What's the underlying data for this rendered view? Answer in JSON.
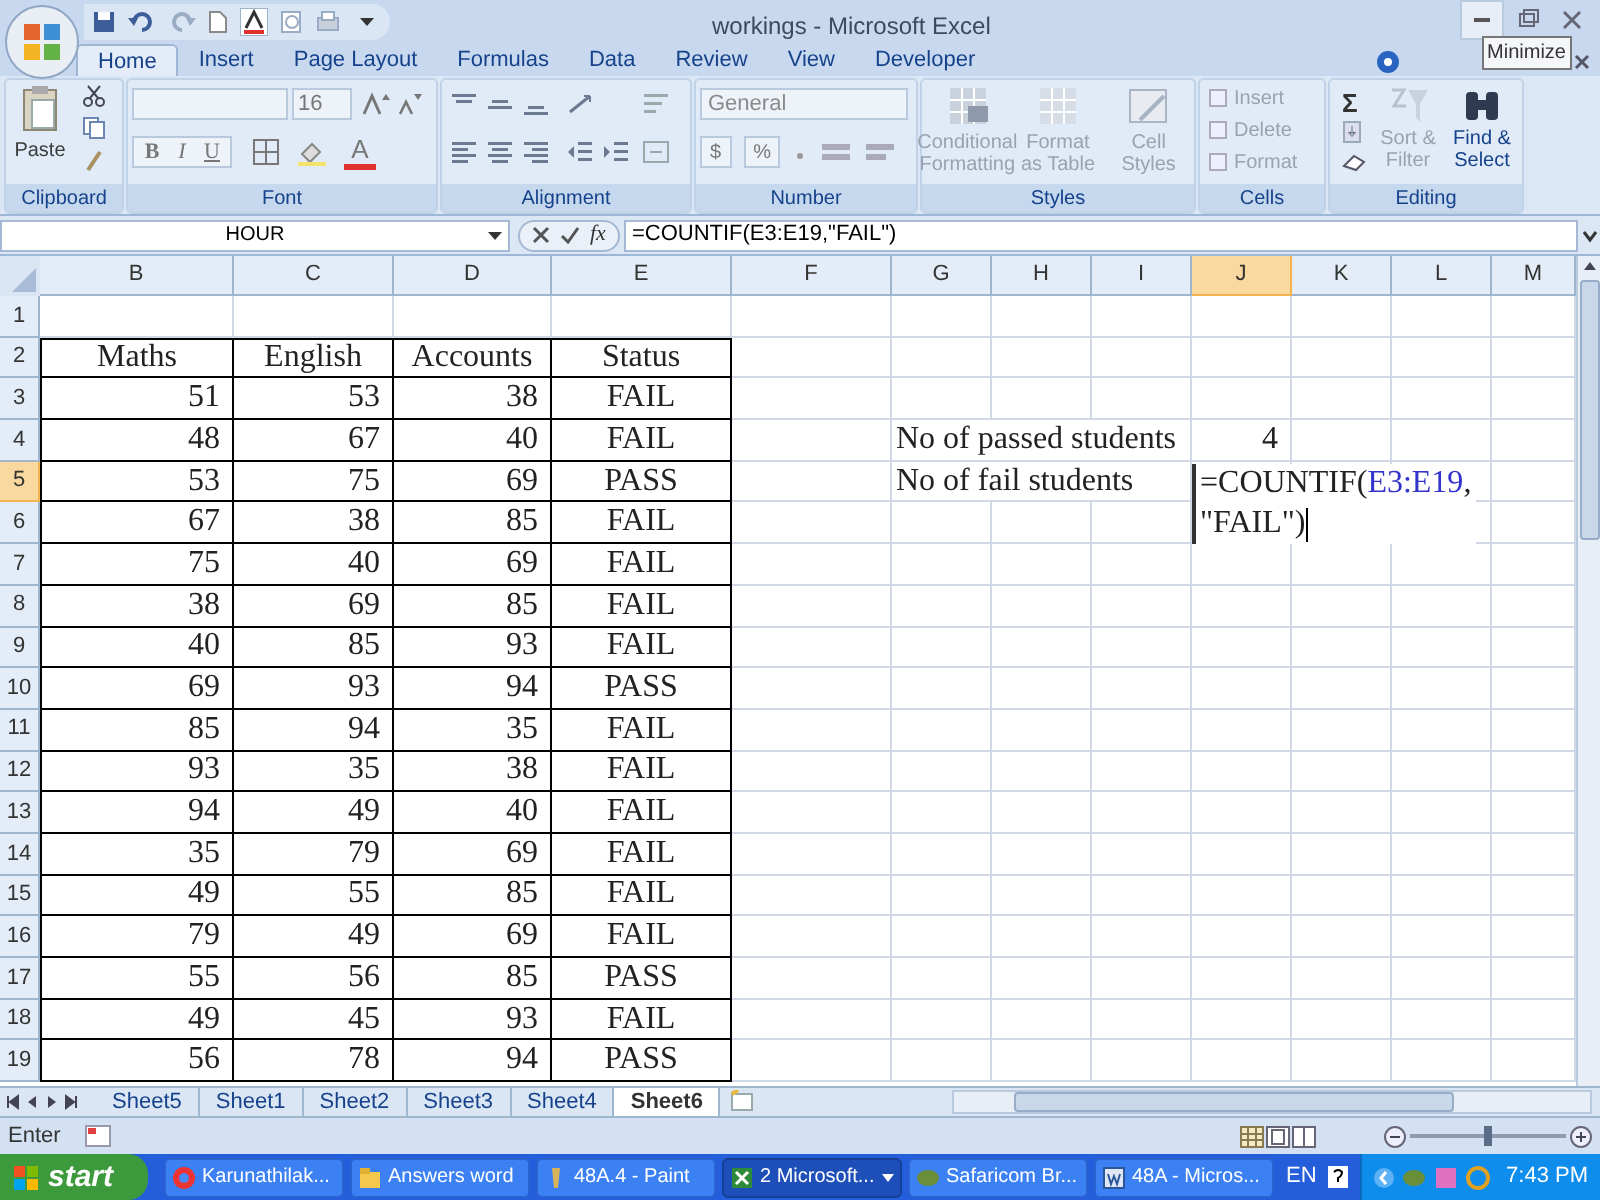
{
  "window": {
    "title": "workings - Microsoft Excel",
    "tooltip": "Minimize"
  },
  "ribbon_tabs": [
    {
      "label": "Home",
      "selected": true
    },
    {
      "label": "Insert",
      "selected": false
    },
    {
      "label": "Page Layout",
      "selected": false
    },
    {
      "label": "Formulas",
      "selected": false
    },
    {
      "label": "Data",
      "selected": false
    },
    {
      "label": "Review",
      "selected": false
    },
    {
      "label": "View",
      "selected": false
    },
    {
      "label": "Developer",
      "selected": false
    }
  ],
  "ribbon": {
    "paste": "Paste",
    "font_size": "16",
    "font_styles": [
      "B",
      "I",
      "U"
    ],
    "font_color_letter": "A",
    "number_format": "General",
    "number_symbols": [
      "$",
      "%"
    ],
    "styles": [
      "Conditional Formatting",
      "Format as Table",
      "Cell Styles"
    ],
    "cells": [
      "Insert",
      "Delete",
      "Format"
    ],
    "sum_symbol": "Σ",
    "editing": [
      "Sort & Filter",
      "Find & Select"
    ],
    "groups": [
      "Clipboard",
      "Font",
      "Alignment",
      "Number",
      "Styles",
      "Cells",
      "Editing"
    ]
  },
  "formula_bar": {
    "name_box": "HOUR",
    "fx": "fx",
    "formula": "=COUNTIF(E3:E19,\"FAIL\")"
  },
  "columns": [
    {
      "label": "B",
      "selected": false
    },
    {
      "label": "C",
      "selected": false
    },
    {
      "label": "D",
      "selected": false
    },
    {
      "label": "E",
      "selected": false
    },
    {
      "label": "F",
      "selected": false
    },
    {
      "label": "G",
      "selected": false
    },
    {
      "label": "H",
      "selected": false
    },
    {
      "label": "I",
      "selected": false
    },
    {
      "label": "J",
      "selected": true
    },
    {
      "label": "K",
      "selected": false
    },
    {
      "label": "L",
      "selected": false
    },
    {
      "label": "M",
      "selected": false
    }
  ],
  "row_numbers": [
    {
      "number": "1",
      "selected": false
    },
    {
      "number": "2",
      "selected": false
    },
    {
      "number": "3",
      "selected": false
    },
    {
      "number": "4",
      "selected": false
    },
    {
      "number": "5",
      "selected": true
    },
    {
      "number": "6",
      "selected": false
    },
    {
      "number": "7",
      "selected": false
    },
    {
      "number": "8",
      "selected": false
    },
    {
      "number": "9",
      "selected": false
    },
    {
      "number": "10",
      "selected": false
    },
    {
      "number": "11",
      "selected": false
    },
    {
      "number": "12",
      "selected": false
    },
    {
      "number": "13",
      "selected": false
    },
    {
      "number": "14",
      "selected": false
    },
    {
      "number": "15",
      "selected": false
    },
    {
      "number": "16",
      "selected": false
    },
    {
      "number": "17",
      "selected": false
    },
    {
      "number": "18",
      "selected": false
    },
    {
      "number": "19",
      "selected": false
    }
  ],
  "table": {
    "header": [
      "Maths",
      "English",
      "Accounts",
      "Status"
    ],
    "rows": [
      [
        "51",
        "53",
        "38",
        "FAIL"
      ],
      [
        "48",
        "67",
        "40",
        "FAIL"
      ],
      [
        "53",
        "75",
        "69",
        "PASS"
      ],
      [
        "67",
        "38",
        "85",
        "FAIL"
      ],
      [
        "75",
        "40",
        "69",
        "FAIL"
      ],
      [
        "38",
        "69",
        "85",
        "FAIL"
      ],
      [
        "40",
        "85",
        "93",
        "FAIL"
      ],
      [
        "69",
        "93",
        "94",
        "PASS"
      ],
      [
        "85",
        "94",
        "35",
        "FAIL"
      ],
      [
        "93",
        "35",
        "38",
        "FAIL"
      ],
      [
        "94",
        "49",
        "40",
        "FAIL"
      ],
      [
        "35",
        "79",
        "69",
        "FAIL"
      ],
      [
        "49",
        "55",
        "85",
        "FAIL"
      ],
      [
        "79",
        "49",
        "69",
        "FAIL"
      ],
      [
        "55",
        "56",
        "85",
        "PASS"
      ],
      [
        "49",
        "45",
        "93",
        "FAIL"
      ],
      [
        "56",
        "78",
        "94",
        "PASS"
      ]
    ]
  },
  "summary": [
    {
      "label": "No of passed students",
      "value": "4"
    },
    {
      "label": "No of fail students"
    }
  ],
  "cell_editor": {
    "lines": [
      [
        {
          "text": "=COUNTIF(",
          "kind": "plain"
        },
        {
          "text": "E3:E19",
          "kind": "reference"
        },
        {
          "text": ",",
          "kind": "plain"
        }
      ],
      [
        {
          "text": "\"FAIL\")",
          "kind": "plain"
        }
      ]
    ]
  },
  "sheet_tabs": [
    {
      "label": "Sheet5",
      "selected": false
    },
    {
      "label": "Sheet1",
      "selected": false
    },
    {
      "label": "Sheet2",
      "selected": false
    },
    {
      "label": "Sheet3",
      "selected": false
    },
    {
      "label": "Sheet4",
      "selected": false
    },
    {
      "label": "Sheet6",
      "selected": true
    }
  ],
  "status_bar": {
    "mode": "Enter",
    "zoom": {
      "level": 0.5
    }
  },
  "taskbar": {
    "start": "start",
    "tasks": [
      {
        "label": "Karunathilak...",
        "kind": "browser",
        "selected": false
      },
      {
        "label": "Answers word",
        "kind": "folder",
        "selected": false
      },
      {
        "label": "48A.4 - Paint",
        "kind": "paint",
        "selected": false
      },
      {
        "label": "2 Microsoft...",
        "kind": "excel",
        "selected": true
      },
      {
        "label": "Safaricom Br...",
        "kind": "modem",
        "selected": false
      },
      {
        "label": "48A - Micros...",
        "kind": "word",
        "selected": false
      }
    ],
    "language": "EN",
    "clock": "7:43 PM"
  }
}
